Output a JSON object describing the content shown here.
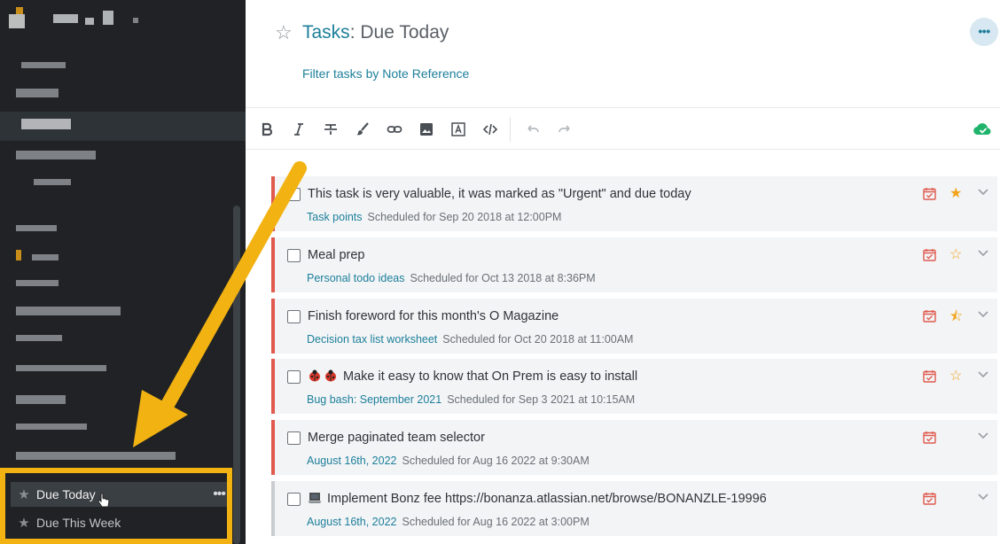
{
  "header": {
    "title_prefix": "Tasks",
    "title_rest": ": Due Today",
    "filter_link": "Filter tasks by Note Reference",
    "menu_glyph": "•••"
  },
  "sidebar": {
    "favorites": [
      {
        "label": "Due Today",
        "star": "★",
        "active": true
      },
      {
        "label": "Due This Week",
        "star": "★",
        "active": false
      }
    ],
    "more_glyph": "•••"
  },
  "toolbar": {
    "icons": [
      "bold-icon",
      "italic-icon",
      "strikethrough-icon",
      "brush-icon",
      "link-icon",
      "image-icon",
      "text-box-icon",
      "code-icon",
      "undo-icon",
      "redo-icon"
    ],
    "sync_status_icon": "cloud-check-icon"
  },
  "tasks": [
    {
      "title": "This task is very valuable, it was marked as \"Urgent\" and due today",
      "ref": "Task points",
      "schedule": "Scheduled for Sep 20 2018 at 12:00PM",
      "star": "★",
      "flagged": true
    },
    {
      "title": "Meal prep",
      "ref": "Personal todo ideas",
      "schedule": "Scheduled for Oct 13 2018 at 8:36PM",
      "star": "☆",
      "flagged": true
    },
    {
      "title": "Finish foreword for this month's O Magazine",
      "ref": "Decision tax list worksheet",
      "schedule": "Scheduled for Oct 20 2018 at 11:00AM",
      "star": "⯪",
      "flagged": true
    },
    {
      "title": "Make it easy to know that On Prem is easy to install",
      "ref": "Bug bash: September 2021",
      "schedule": "Scheduled for Sep 3 2021 at 10:15AM",
      "star": "☆",
      "flagged": true
    },
    {
      "title": "Merge paginated team selector",
      "ref": "August 16th, 2022",
      "schedule": "Scheduled for Aug 16 2022 at 9:30AM",
      "star": "",
      "flagged": true
    },
    {
      "title": "Implement Bonz fee https://bonanza.atlassian.net/browse/BONANZLE-19996",
      "ref": "August 16th, 2022",
      "schedule": "Scheduled for Aug 16 2022 at 3:00PM",
      "star": "",
      "flagged": false
    }
  ],
  "colors": {
    "accent": "#1d7f9a",
    "urgent": "#e05a4e",
    "star": "#f2a31b",
    "callout": "#f2b212",
    "sidebar_bg": "#202225"
  }
}
